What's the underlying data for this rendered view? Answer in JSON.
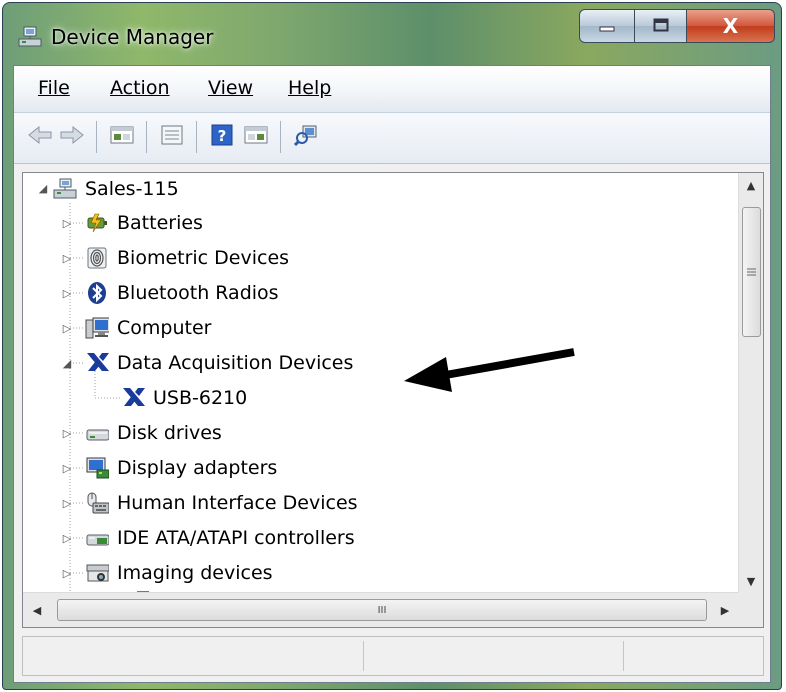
{
  "window": {
    "title": "Device Manager",
    "close_glyph": "X"
  },
  "menu": [
    {
      "label": "File"
    },
    {
      "label": "Action"
    },
    {
      "label": "View"
    },
    {
      "label": "Help"
    }
  ],
  "toolbar": {
    "buttons": [
      {
        "icon": "back-arrow-icon"
      },
      {
        "icon": "forward-arrow-icon"
      },
      {
        "icon": "show-hide-tree-icon"
      },
      {
        "icon": "properties-icon"
      },
      {
        "icon": "help-icon"
      },
      {
        "icon": "show-hide-action-pane-icon"
      },
      {
        "icon": "scan-hardware-changes-icon"
      }
    ]
  },
  "tree": {
    "root": {
      "label": "Sales-115",
      "icon": "computer-network-icon",
      "expanded": true
    },
    "items": [
      {
        "label": "Batteries",
        "icon": "battery-icon",
        "expanded": false
      },
      {
        "label": "Biometric Devices",
        "icon": "fingerprint-icon",
        "expanded": false
      },
      {
        "label": "Bluetooth Radios",
        "icon": "bluetooth-icon",
        "expanded": false
      },
      {
        "label": "Computer",
        "icon": "computer-icon",
        "expanded": false
      },
      {
        "label": "Data Acquisition Devices",
        "icon": "ni-daq-icon",
        "expanded": true
      },
      {
        "label": "Disk drives",
        "icon": "disk-drive-icon",
        "expanded": false
      },
      {
        "label": "Display adapters",
        "icon": "display-adapter-icon",
        "expanded": false
      },
      {
        "label": "Human Interface Devices",
        "icon": "hid-icon",
        "expanded": false
      },
      {
        "label": "IDE ATA/ATAPI controllers",
        "icon": "ide-controller-icon",
        "expanded": false
      },
      {
        "label": "Imaging devices",
        "icon": "imaging-device-icon",
        "expanded": false
      }
    ],
    "child": {
      "label": "USB-6210",
      "icon": "ni-daq-icon",
      "parent": "Data Acquisition Devices"
    }
  },
  "scrollbars": {
    "h_thumb_grip": "III"
  },
  "colors": {
    "ni_blue": "#1a3a9c",
    "close_red": "#c13c1c",
    "annotation_arrow": "#000000"
  }
}
